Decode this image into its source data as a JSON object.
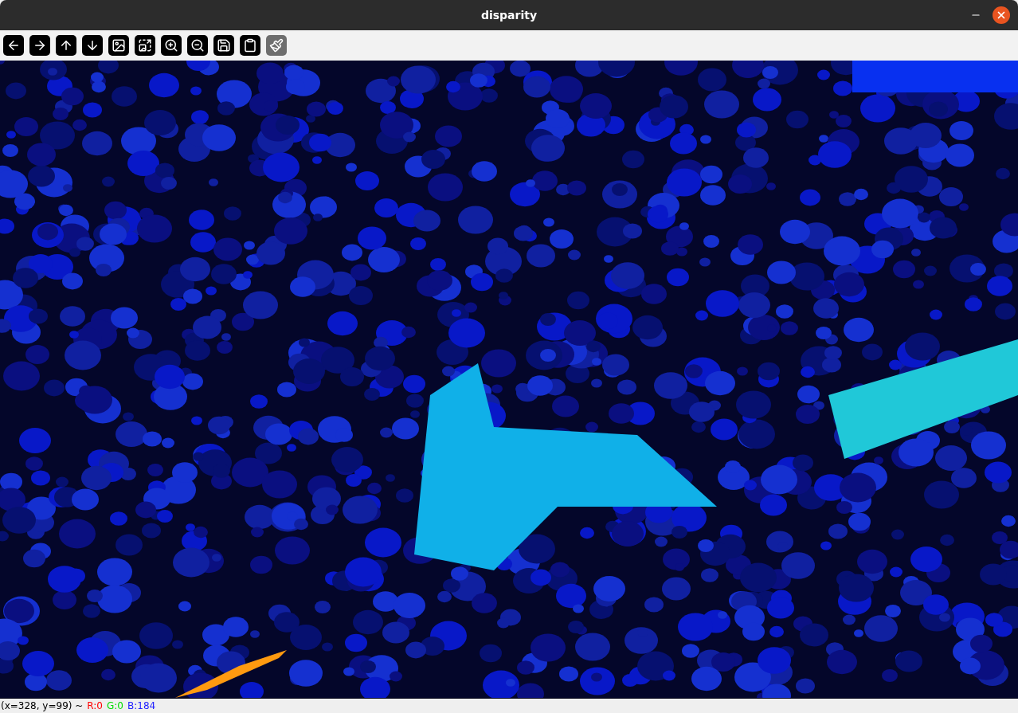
{
  "window": {
    "title": "disparity"
  },
  "toolbar": [
    {
      "kind": "left",
      "disabled": false
    },
    {
      "kind": "right",
      "disabled": false
    },
    {
      "kind": "up",
      "disabled": false
    },
    {
      "kind": "down",
      "disabled": false
    },
    {
      "kind": "image",
      "disabled": false
    },
    {
      "kind": "zoomimage",
      "disabled": false
    },
    {
      "kind": "zoomin",
      "disabled": false
    },
    {
      "kind": "zoomout",
      "disabled": false
    },
    {
      "kind": "save",
      "disabled": false
    },
    {
      "kind": "clipboard",
      "disabled": false
    },
    {
      "kind": "brush",
      "disabled": true
    }
  ],
  "status_bar": {
    "position": "(x=328, y=99) ~",
    "channels": [
      {
        "text": "R:0",
        "color": "#ff0000"
      },
      {
        "text": "G:0",
        "color": "#00dd00"
      },
      {
        "text": "B:184",
        "color": "#2222ff"
      }
    ]
  }
}
